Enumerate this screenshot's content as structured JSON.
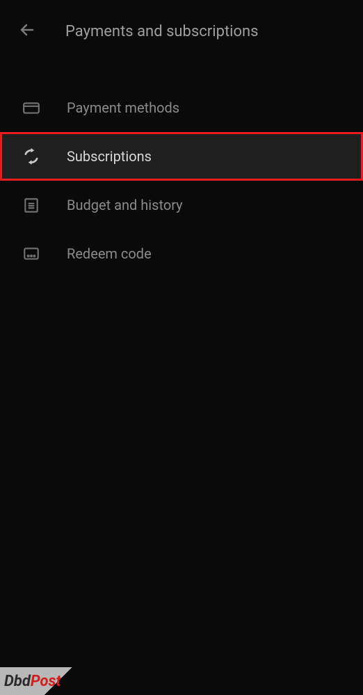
{
  "header": {
    "title": "Payments and subscriptions"
  },
  "menu": {
    "items": [
      {
        "label": "Payment methods",
        "icon": "card-icon",
        "highlighted": false
      },
      {
        "label": "Subscriptions",
        "icon": "sync-icon",
        "highlighted": true
      },
      {
        "label": "Budget and history",
        "icon": "notepad-icon",
        "highlighted": false
      },
      {
        "label": "Redeem code",
        "icon": "code-icon",
        "highlighted": false
      }
    ]
  },
  "watermark": {
    "part1": "Dbd",
    "part2": "Post"
  },
  "colors": {
    "highlight_border": "#e81c1c",
    "highlight_bg": "#1f1f1f",
    "background": "#0a0a0a"
  }
}
